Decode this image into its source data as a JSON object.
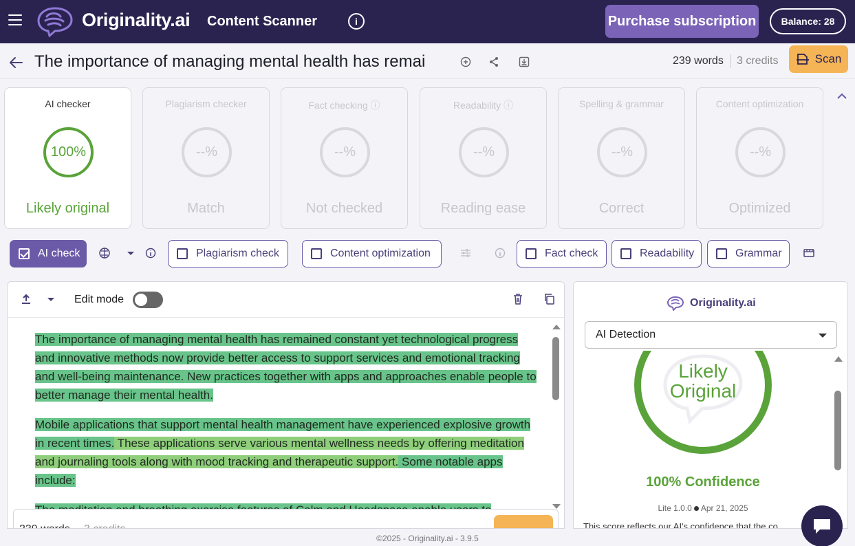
{
  "topbar": {
    "brand": "Originality.ai",
    "app_title": "Content Scanner",
    "purchase_label": "Purchase subscription",
    "balance_label": "Balance: 28"
  },
  "doc": {
    "title": "The importance of managing mental health has remai",
    "words": "239 words",
    "credits": "3 credits",
    "scan_label": "Scan"
  },
  "cards": [
    {
      "label": "AI checker",
      "value": "100%",
      "status": "Likely original",
      "active": true
    },
    {
      "label": "Plagiarism checker",
      "value": "--%",
      "status": "Match",
      "active": false
    },
    {
      "label": "Fact checking ⓘ",
      "value": "--%",
      "status": "Not checked",
      "active": false
    },
    {
      "label": "Readability ⓘ",
      "value": "--%",
      "status": "Reading ease",
      "active": false
    },
    {
      "label": "Spelling & grammar",
      "value": "--%",
      "status": "Correct",
      "active": false
    },
    {
      "label": "Content optimization",
      "value": "--%",
      "status": "Optimized",
      "active": false
    }
  ],
  "checks": {
    "ai": "AI check",
    "plagiarism": "Plagiarism check",
    "content_opt": "Content optimization",
    "fact": "Fact check",
    "readability": "Readability",
    "grammar": "Grammar"
  },
  "editor": {
    "edit_mode_label": "Edit mode",
    "para1": "The importance of managing mental health has remained constant yet technological progress and innovative methods now provide better access to support services and emotional tracking and well-being maintenance.  New practices together with apps and approaches enable people to better manage their mental health.",
    "para2a": "Mobile applications that support mental health management have experienced explosive growth in recent times.",
    "para2b": "  These applications serve various mental wellness needs by offering meditation and journaling tools along with mood tracking and therapeutic support.",
    "para2c": "  Some notable apps include:",
    "para3": "The meditation and breathing exercise features of Calm and Headspace enable users to",
    "bottom_wc": "239 words",
    "bottom_credits": "3 credits"
  },
  "right_panel": {
    "brand": "Originality.ai",
    "select_value": "AI Detection",
    "ring_label_1": "Likely",
    "ring_label_2": "Original",
    "confidence": "100% Confidence",
    "version": "Lite 1.0.0",
    "date": "Apr 21, 2025",
    "description": "This score reflects our AI's confidence that the co"
  },
  "footer": "©2025 - Originality.ai - 3.9.5",
  "colors": {
    "topbar": "#2a2350",
    "accent_purple": "#6b5aa8",
    "scan_orange": "#f5b456",
    "green": "#5aa33a",
    "highlight": "#68c48a"
  }
}
